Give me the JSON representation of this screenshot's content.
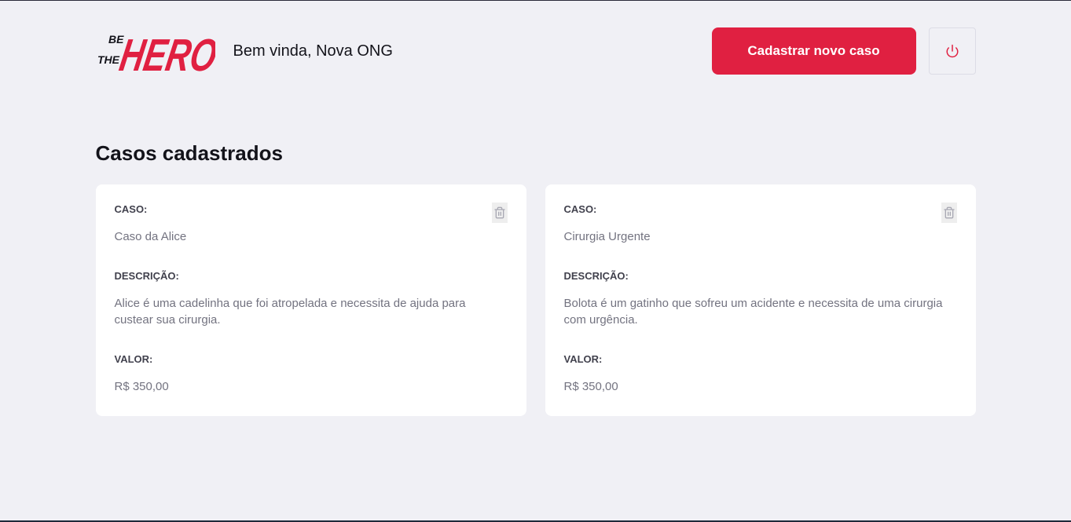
{
  "header": {
    "logo": {
      "line1": "BE",
      "line2": "THE",
      "word": "HERO"
    },
    "welcome": "Bem vinda, Nova ONG",
    "new_case_label": "Cadastrar novo caso"
  },
  "page_title": "Casos cadastrados",
  "cases": [
    {
      "case_label": "CASO:",
      "case_value": "Caso da Alice",
      "description_label": "DESCRIÇÃO:",
      "description_value": "Alice é uma cadelinha que foi atropelada e necessita de ajuda para custear sua cirurgia.",
      "value_label": "VALOR:",
      "value_value": "R$ 350,00"
    },
    {
      "case_label": "CASO:",
      "case_value": "Cirurgia Urgente",
      "description_label": "DESCRIÇÃO:",
      "description_value": "Bolota é um gatinho que sofreu um acidente e necessita de uma cirurgia com urgência.",
      "value_label": "VALOR:",
      "value_value": "R$ 350,00"
    }
  ],
  "icons": {
    "logout": "power-icon",
    "delete": "trash-icon"
  },
  "colors": {
    "brand": "#e02041",
    "background": "#f0f0f5",
    "card": "#ffffff",
    "label": "#41414d",
    "text": "#737380",
    "trash": "#a8a8b3"
  }
}
